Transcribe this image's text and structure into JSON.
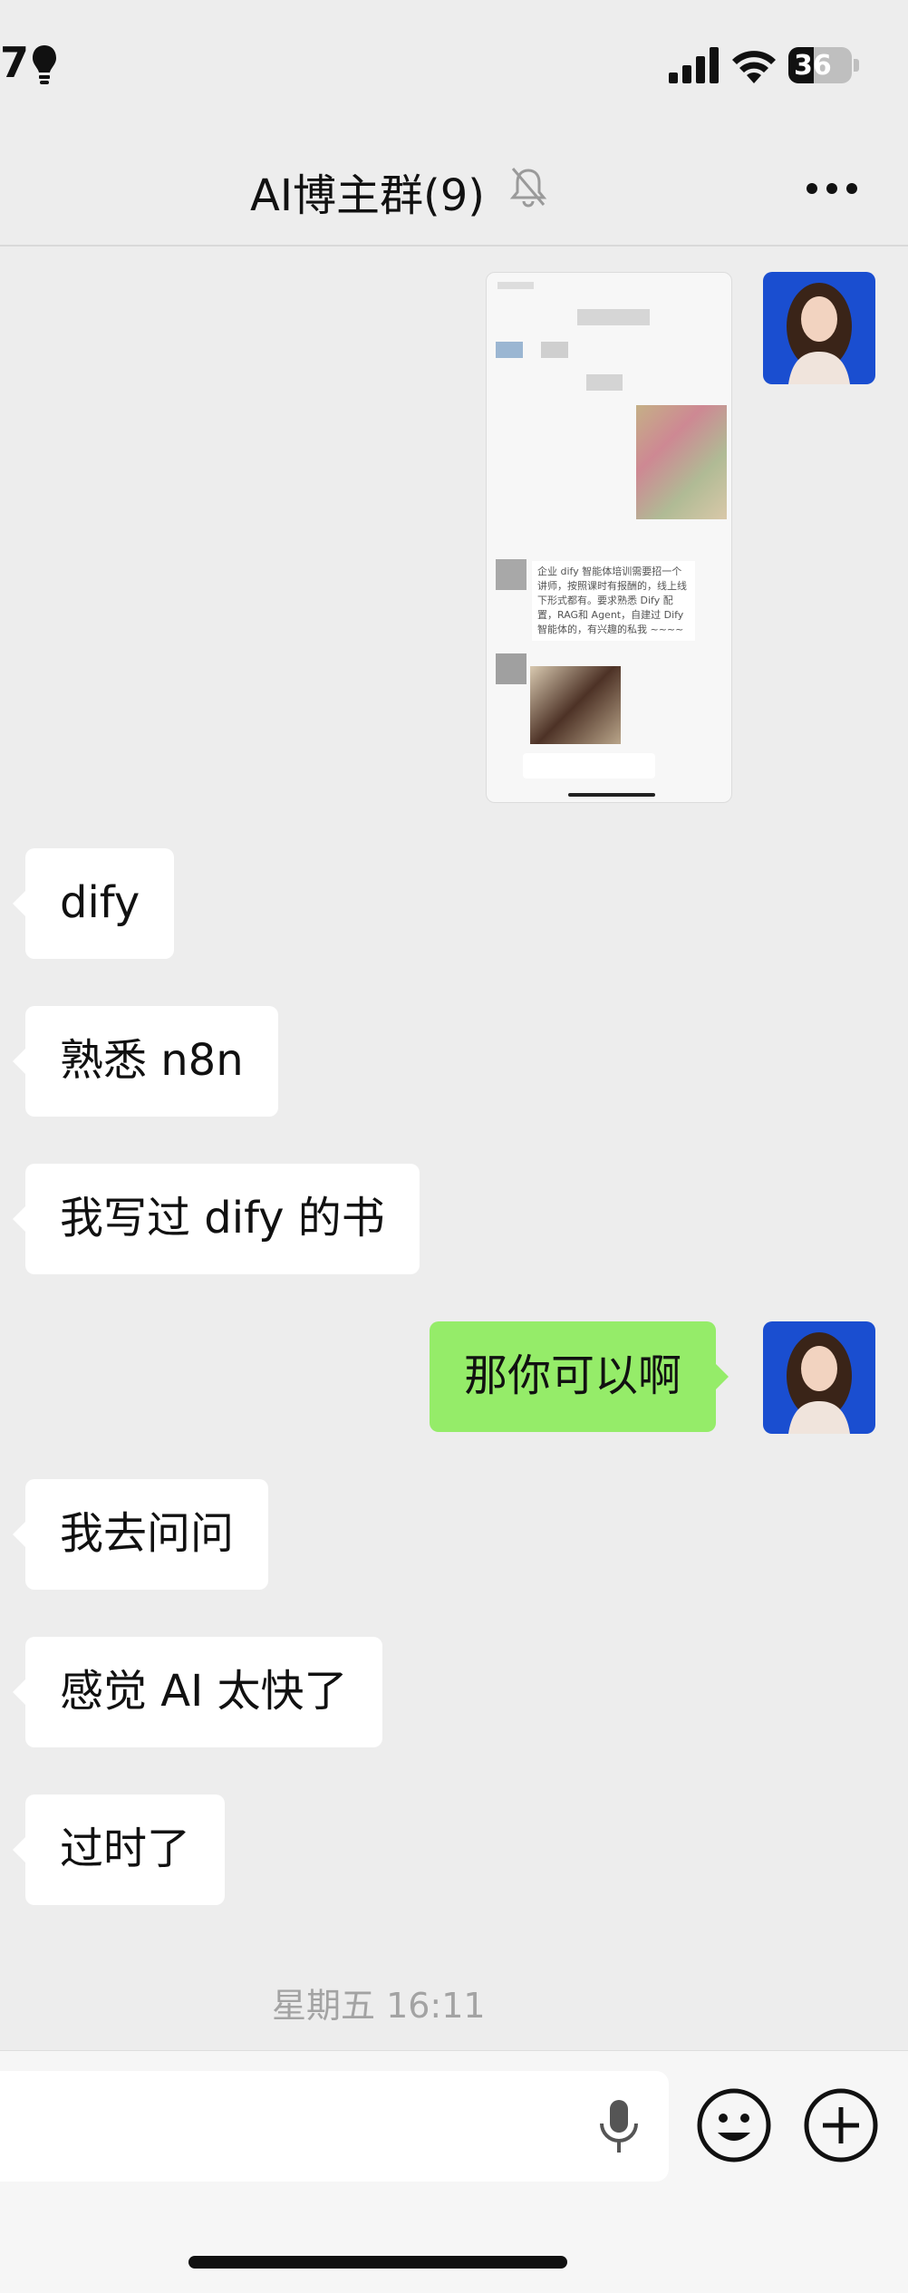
{
  "status_bar": {
    "time": "7",
    "battery": "36"
  },
  "header": {
    "title": "AI博主群(9)"
  },
  "shared_image": {
    "text": "企业 dify 智能体培训需要招一个讲师，按照课时有报酬的，线上线下形式都有。要求熟悉 Dify 配置，RAG和 Agent，自建过 Dify 智能体的，有兴趣的私我 ~~~~"
  },
  "messages": [
    {
      "side": "left",
      "text": "dify"
    },
    {
      "side": "left",
      "text": "熟悉 n8n"
    },
    {
      "side": "left",
      "text": "我写过 dify 的书"
    },
    {
      "side": "right",
      "text": "那你可以啊"
    },
    {
      "side": "left",
      "text": "我去问问"
    },
    {
      "side": "left",
      "text": "感觉 AI 太快了"
    },
    {
      "side": "left",
      "text": "过时了"
    }
  ],
  "timestamp": "星期五 16:11",
  "colors": {
    "background": "#ededed",
    "bubble_self": "#95ec69",
    "bubble_other": "#ffffff"
  }
}
